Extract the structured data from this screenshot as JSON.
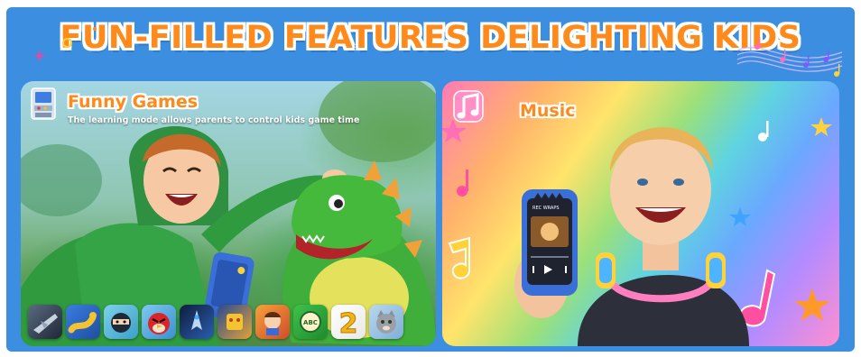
{
  "banner": {
    "title": "FUN-FILLED FEATURES DELIGHTING KIDS"
  },
  "panels": [
    {
      "id": "games",
      "title": "Funny Games",
      "description": "The learning mode allows parents to control kids game time",
      "icon": "arcade-machine-icon"
    },
    {
      "id": "music",
      "title": "Music",
      "icon": "music-note-icon"
    }
  ],
  "game_icons": [
    "silver-jet-game-icon",
    "snake-game-icon",
    "ninja-game-icon",
    "angry-bird-game-icon",
    "space-shooter-game-icon",
    "robot-battle-game-icon",
    "cartoon-fighter-game-icon",
    "word-puzzle-game-icon",
    "number-two-game-icon",
    "talking-cat-game-icon"
  ],
  "phone_screen": {
    "label": "REC WRAPS"
  },
  "colors": {
    "banner_blue": "#3c8fe0",
    "title_orange": "#ff8a1c",
    "phone_blue": "#3b6fd8"
  }
}
